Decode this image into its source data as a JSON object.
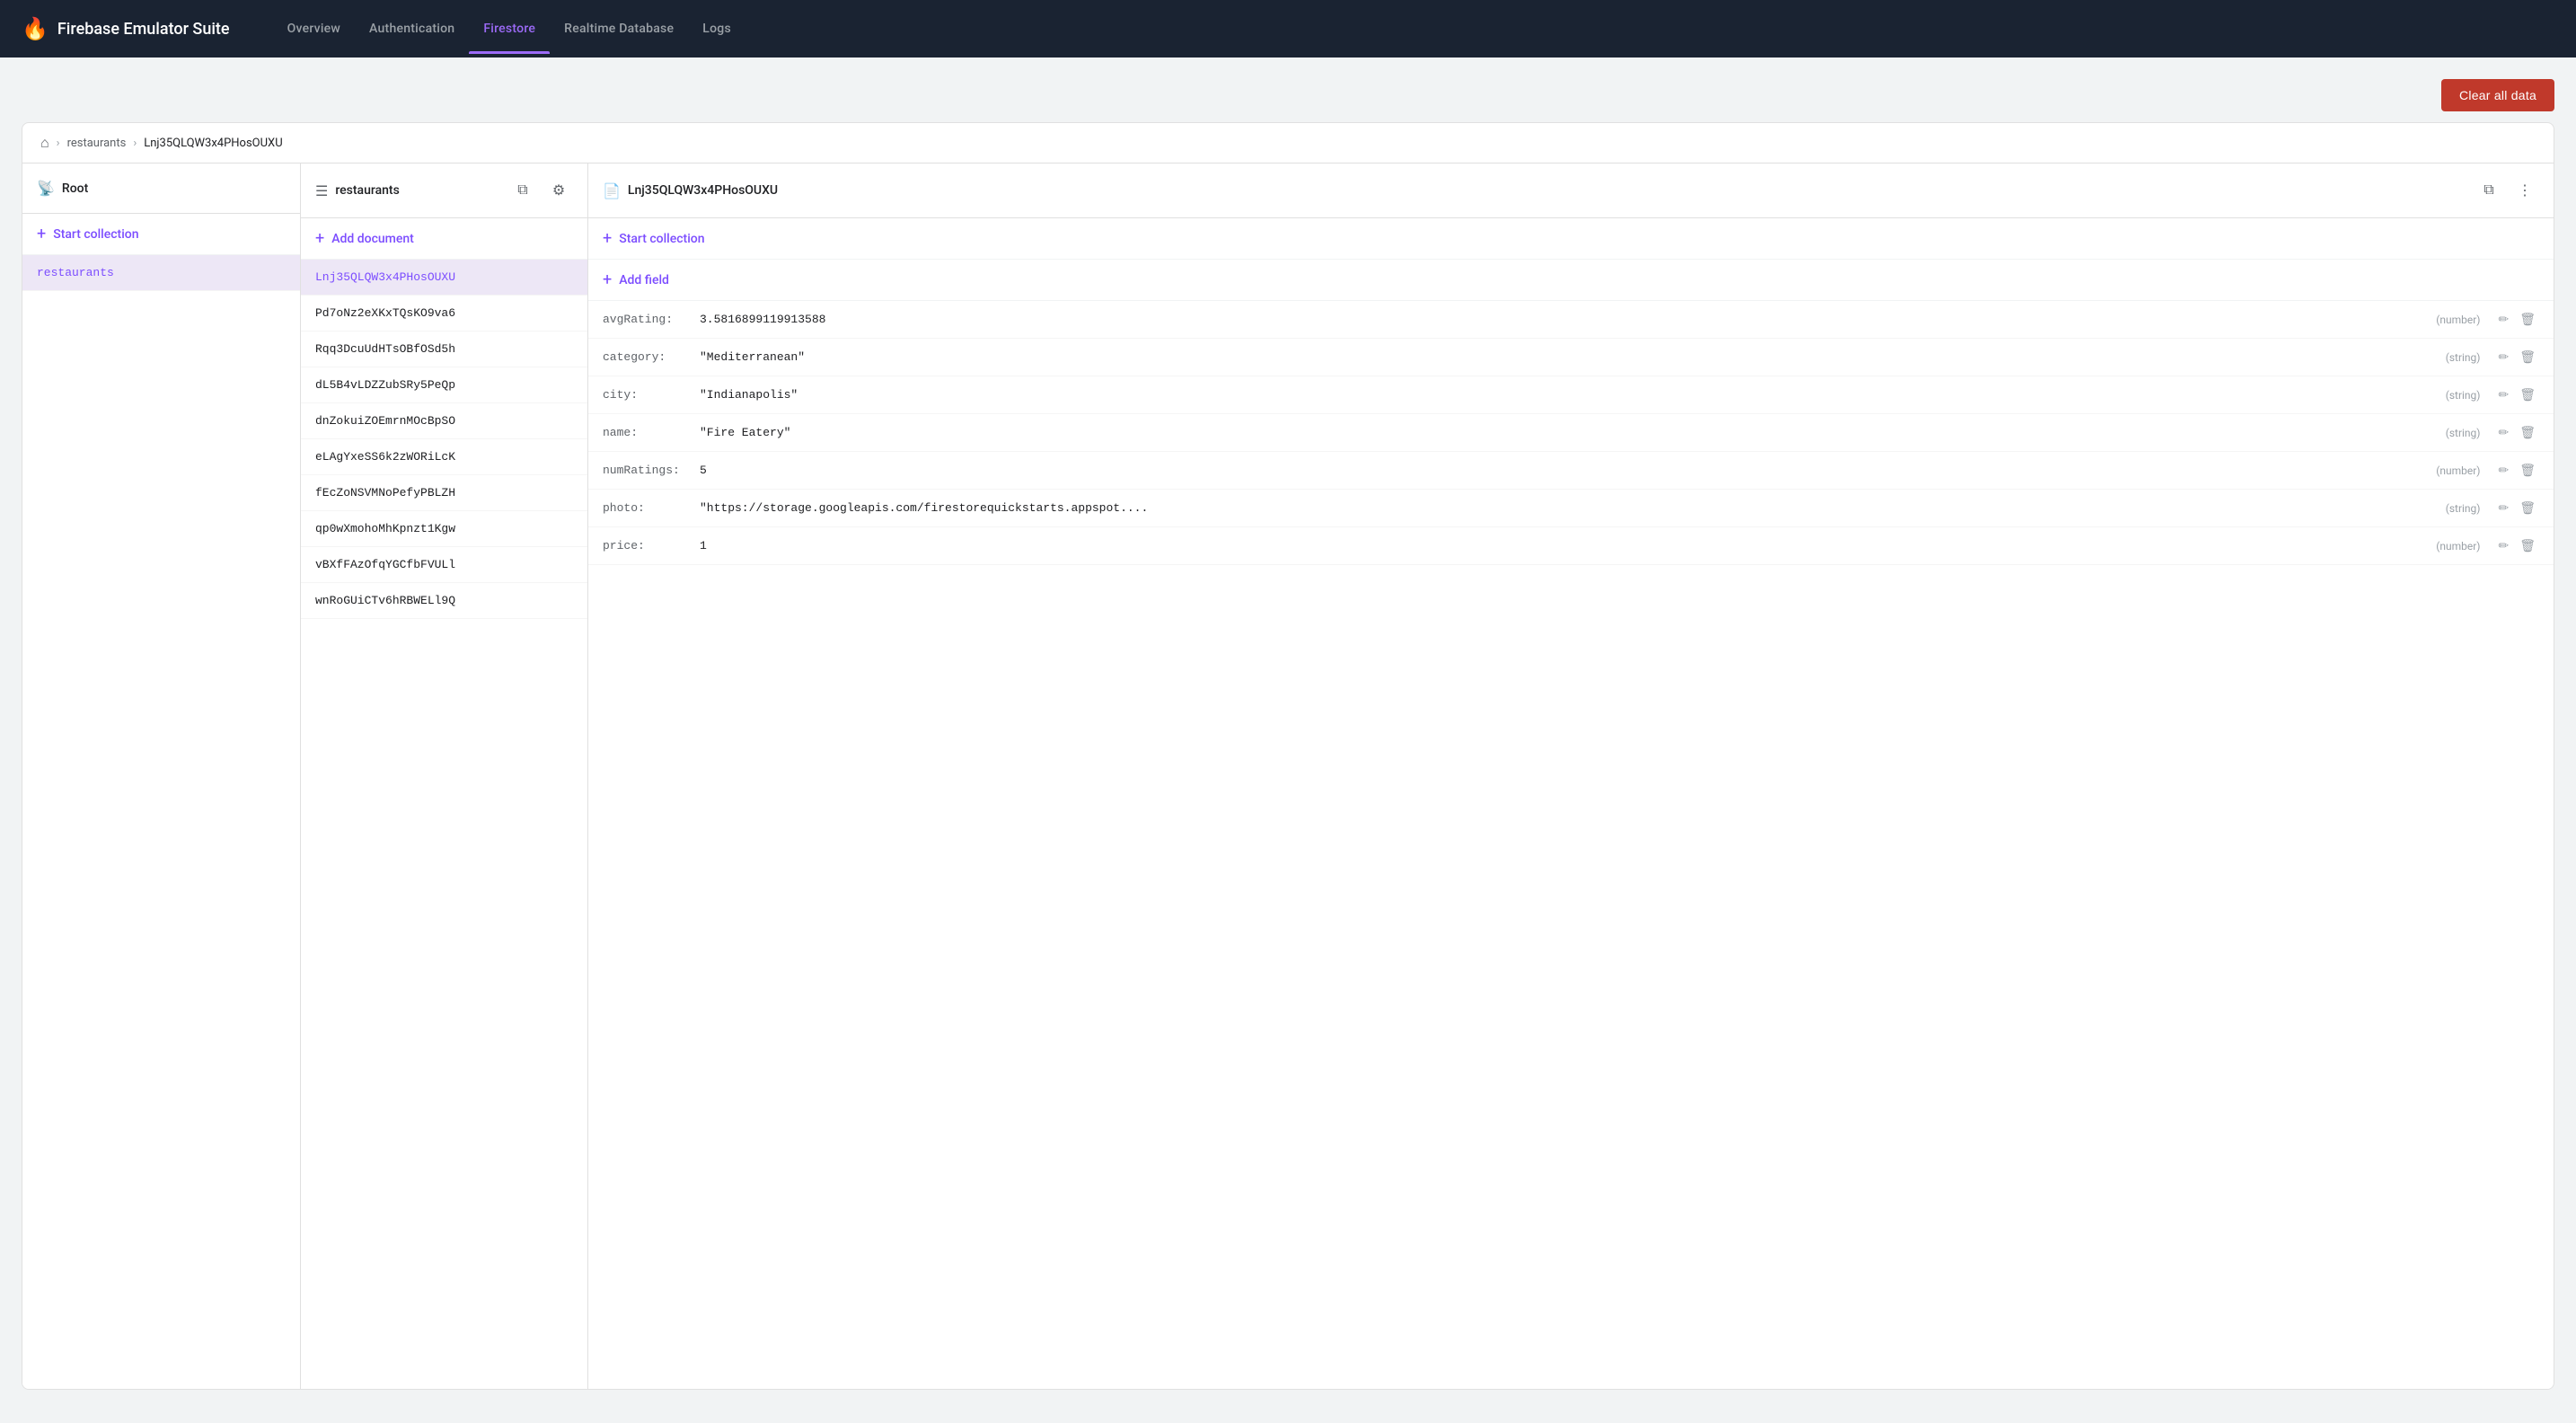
{
  "app": {
    "title": "Firebase Emulator Suite",
    "fire_icon": "🔥"
  },
  "nav": {
    "links": [
      {
        "label": "Overview",
        "active": false
      },
      {
        "label": "Authentication",
        "active": false
      },
      {
        "label": "Firestore",
        "active": true
      },
      {
        "label": "Realtime Database",
        "active": false
      },
      {
        "label": "Logs",
        "active": false
      }
    ]
  },
  "toolbar": {
    "clear_all_label": "Clear all data"
  },
  "breadcrumb": {
    "home_icon": "⌂",
    "separator": "›",
    "path": [
      {
        "label": "restaurants",
        "link": true
      },
      {
        "label": "Lnj35QLQW3x4PHosOUXU",
        "link": false
      }
    ]
  },
  "panels": {
    "root": {
      "icon": "⌂",
      "title": "Root",
      "actions": {
        "start_collection_label": "+ Start collection"
      },
      "items": [
        {
          "label": "restaurants",
          "selected": true
        }
      ]
    },
    "collection": {
      "icon": "☰",
      "title": "restaurants",
      "actions": {
        "add_document_label": "+ Add document",
        "copy_tooltip": "Copy",
        "filter_tooltip": "Filter"
      },
      "items": [
        {
          "label": "Lnj35QLQW3x4PHosOUXU",
          "selected": true
        },
        {
          "label": "Pd7oNz2eXKxTQsKO9va6",
          "selected": false
        },
        {
          "label": "Rqq3DcuUdHTsOBfOSd5h",
          "selected": false
        },
        {
          "label": "dL5B4vLDZZubSRy5PeQp",
          "selected": false
        },
        {
          "label": "dnZokuiZOEmrnMOcBpSO",
          "selected": false
        },
        {
          "label": "eLAgYxeSS6k2zWORiLcK",
          "selected": false
        },
        {
          "label": "fEcZoNSVMNoPefyPBLZH",
          "selected": false
        },
        {
          "label": "qp0wXmohoMhKpnzt1Kgw",
          "selected": false
        },
        {
          "label": "vBXfFAzOfqYGCfbFVULl",
          "selected": false
        },
        {
          "label": "wnRoGUiCTv6hRBWELl9Q",
          "selected": false
        }
      ]
    },
    "document": {
      "icon": "📄",
      "title": "Lnj35QLQW3x4PHosOUXU",
      "actions": {
        "start_collection_label": "+ Start collection",
        "add_field_label": "+ Add field",
        "copy_tooltip": "Copy",
        "more_tooltip": "More"
      },
      "fields": [
        {
          "key": "avgRating:",
          "value": "3.5816899119913588",
          "type": "(number)"
        },
        {
          "key": "category:",
          "value": "\"Mediterranean\"",
          "type": "(string)"
        },
        {
          "key": "city:",
          "value": "\"Indianapolis\"",
          "type": "(string)"
        },
        {
          "key": "name:",
          "value": "\"Fire Eatery\"",
          "type": "(string)"
        },
        {
          "key": "numRatings:",
          "value": "5",
          "type": "(number)"
        },
        {
          "key": "photo:",
          "value": "\"https://storage.googleapis.com/firestorequickstarts.appspot....",
          "type": "(string)"
        },
        {
          "key": "price:",
          "value": "1",
          "type": "(number)"
        }
      ]
    }
  }
}
